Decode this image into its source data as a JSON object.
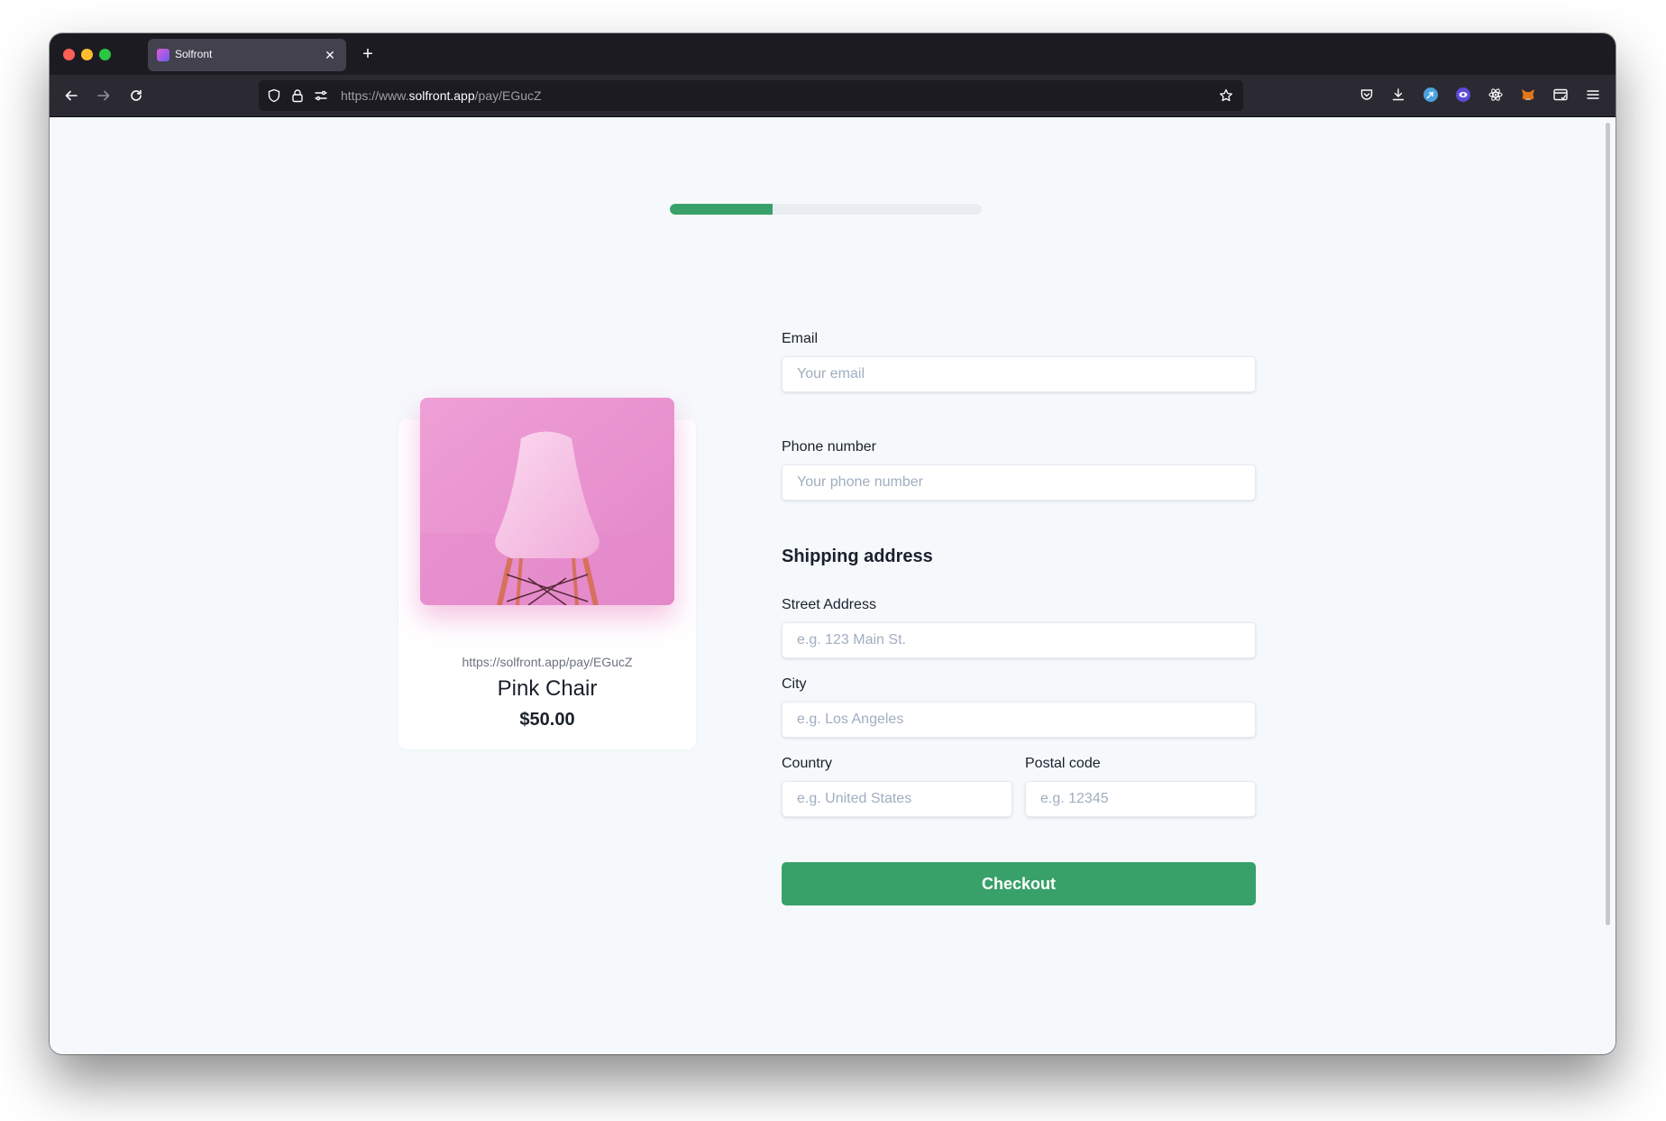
{
  "browser": {
    "tab_title": "Solfront",
    "url_prefix": "https://www.",
    "url_domain": "solfront.app",
    "url_path": "/pay/EGucZ"
  },
  "checkout_progress": 0.33,
  "product": {
    "link": "https://solfront.app/pay/EGucZ",
    "name": "Pink Chair",
    "price": "$50.00"
  },
  "form": {
    "email_label": "Email",
    "email_placeholder": "Your email",
    "phone_label": "Phone number",
    "phone_placeholder": "Your phone number",
    "shipping_heading": "Shipping address",
    "street_label": "Street Address",
    "street_placeholder": "e.g. 123 Main St.",
    "city_label": "City",
    "city_placeholder": "e.g. Los Angeles",
    "country_label": "Country",
    "country_placeholder": "e.g. United States",
    "postal_label": "Postal code",
    "postal_placeholder": "e.g. 12345",
    "checkout_label": "Checkout"
  },
  "colors": {
    "accent": "#38a169",
    "page_background": "#f6f9fc"
  }
}
